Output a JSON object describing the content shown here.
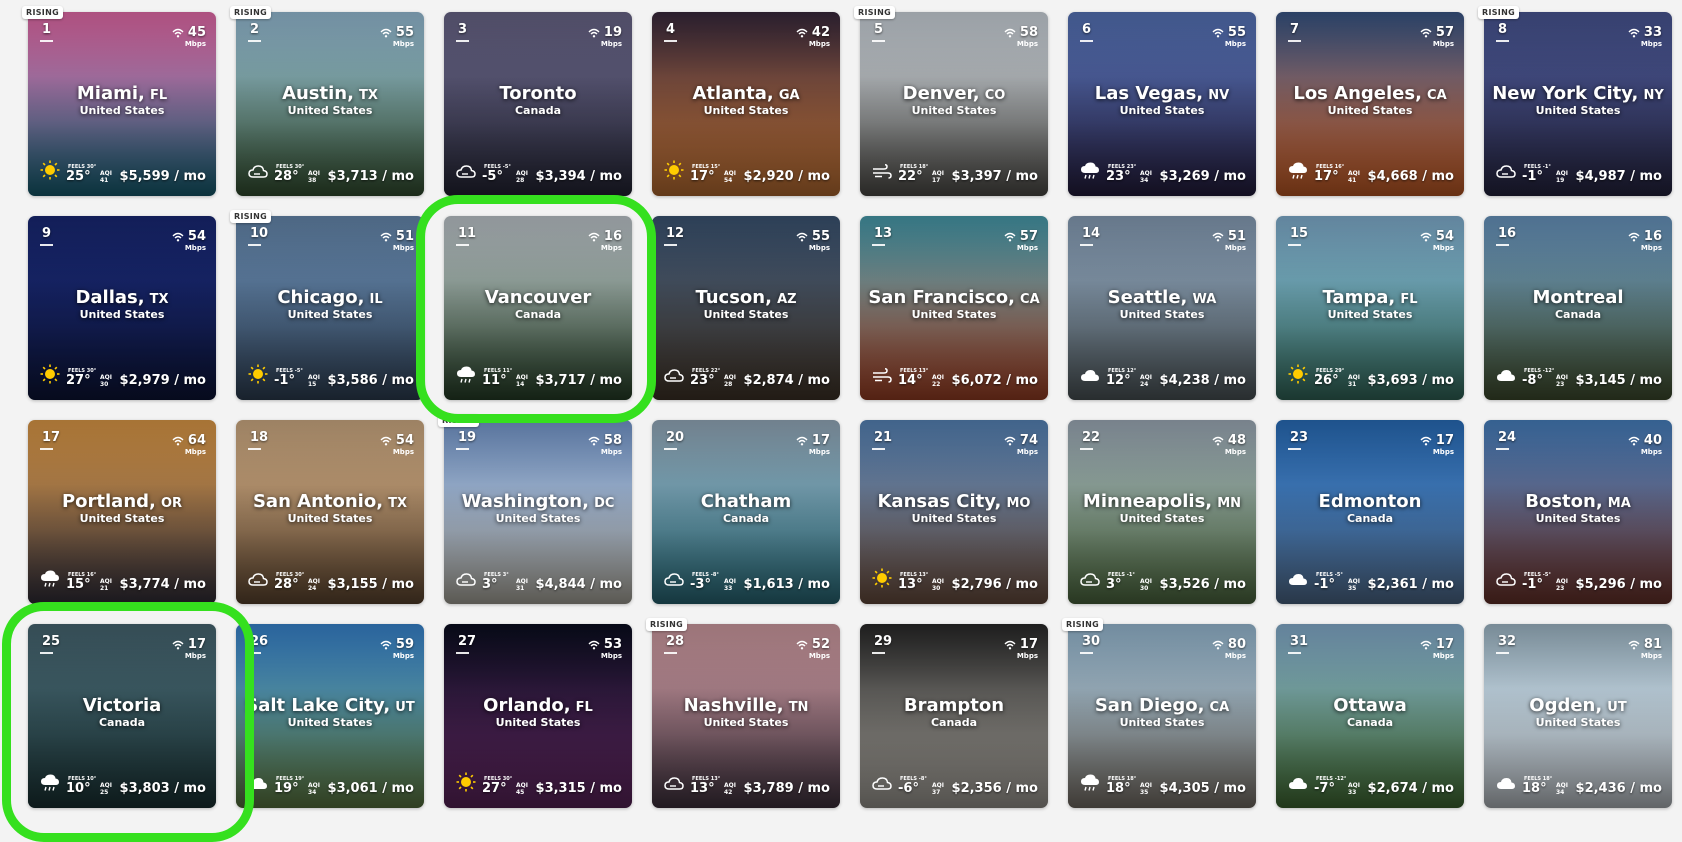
{
  "rising_label": "RISING",
  "wifi_unit": "Mbps",
  "feels_prefix": "FEELS",
  "aqi_label": "AQI",
  "price_suffix": "/ mo",
  "cities": [
    {
      "rank": "1",
      "city": "Miami,",
      "state": "FL",
      "country": "United States",
      "speed": "45",
      "temp": "25°",
      "feels": "30°",
      "aqi": "41",
      "price": "$5,599",
      "weather": "sun",
      "rising": true,
      "colors": [
        "#f06fb0",
        "#1a6f86"
      ]
    },
    {
      "rank": "2",
      "city": "Austin,",
      "state": "TX",
      "country": "United States",
      "speed": "55",
      "temp": "28°",
      "feels": "30°",
      "aqi": "38",
      "price": "$3,713",
      "weather": "cloudy",
      "rising": true,
      "colors": [
        "#9ec6e0",
        "#3d5e3a"
      ]
    },
    {
      "rank": "3",
      "city": "Toronto",
      "state": "",
      "country": "Canada",
      "speed": "19",
      "temp": "-5°",
      "feels": "-5°",
      "aqi": "28",
      "price": "$3,394",
      "weather": "cloudy",
      "rising": false,
      "colors": [
        "#6e6a8e",
        "#2a2b3d"
      ]
    },
    {
      "rank": "4",
      "city": "Atlanta,",
      "state": "GA",
      "country": "United States",
      "speed": "42",
      "temp": "17°",
      "feels": "15°",
      "aqi": "54",
      "price": "$2,920",
      "weather": "sun",
      "rising": false,
      "colors": [
        "#3a2a3e",
        "#d9803a"
      ]
    },
    {
      "rank": "5",
      "city": "Denver,",
      "state": "CO",
      "country": "United States",
      "speed": "58",
      "temp": "22°",
      "feels": "18°",
      "aqi": "17",
      "price": "$3,397",
      "weather": "wind",
      "rising": true,
      "colors": [
        "#d6dee6",
        "#5c5a55"
      ]
    },
    {
      "rank": "6",
      "city": "Las Vegas,",
      "state": "NV",
      "country": "United States",
      "speed": "55",
      "temp": "23°",
      "feels": "23°",
      "aqi": "34",
      "price": "$3,269",
      "weather": "rain",
      "rising": false,
      "colors": [
        "#5a79c0",
        "#2a2248"
      ]
    },
    {
      "rank": "7",
      "city": "Los Angeles,",
      "state": "CA",
      "country": "United States",
      "speed": "57",
      "temp": "17°",
      "feels": "16°",
      "aqi": "41",
      "price": "$4,668",
      "weather": "rain",
      "rising": false,
      "colors": [
        "#3b5a8c",
        "#e36a2a"
      ]
    },
    {
      "rank": "8",
      "city": "New York City,",
      "state": "NY",
      "country": "United States",
      "speed": "33",
      "temp": "-1°",
      "feels": "-1°",
      "aqi": "19",
      "price": "$4,987",
      "weather": "cloudy",
      "rising": true,
      "colors": [
        "#4c5a9a",
        "#2b2a4a"
      ]
    },
    {
      "rank": "9",
      "city": "Dallas,",
      "state": "TX",
      "country": "United States",
      "speed": "54",
      "temp": "27°",
      "feels": "30°",
      "aqi": "30",
      "price": "$2,979",
      "weather": "sun",
      "rising": false,
      "colors": [
        "#1a2a7a",
        "#0e1740"
      ]
    },
    {
      "rank": "10",
      "city": "Chicago,",
      "state": "IL",
      "country": "United States",
      "speed": "51",
      "temp": "-1°",
      "feels": "-5°",
      "aqi": "15",
      "price": "$3,586",
      "weather": "sun",
      "rising": true,
      "colors": [
        "#6b8fb6",
        "#364a62"
      ]
    },
    {
      "rank": "11",
      "city": "Vancouver",
      "state": "",
      "country": "Canada",
      "speed": "16",
      "temp": "11°",
      "feels": "11°",
      "aqi": "14",
      "price": "$3,717",
      "weather": "rain",
      "rising": false,
      "colors": [
        "#c8d0d6",
        "#2d4a2e"
      ]
    },
    {
      "rank": "12",
      "city": "Tucson,",
      "state": "AZ",
      "country": "United States",
      "speed": "55",
      "temp": "23°",
      "feels": "22°",
      "aqi": "28",
      "price": "$2,874",
      "weather": "cloudy",
      "rising": false,
      "colors": [
        "#3e5878",
        "#4a3c2e"
      ]
    },
    {
      "rank": "13",
      "city": "San Francisco,",
      "state": "CA",
      "country": "United States",
      "speed": "57",
      "temp": "14°",
      "feels": "13°",
      "aqi": "22",
      "price": "$6,072",
      "weather": "wind",
      "rising": false,
      "colors": [
        "#4aa3b5",
        "#b84a2a"
      ]
    },
    {
      "rank": "14",
      "city": "Seattle,",
      "state": "WA",
      "country": "United States",
      "speed": "51",
      "temp": "12°",
      "feels": "12°",
      "aqi": "24",
      "price": "$4,238",
      "weather": "cloud",
      "rising": false,
      "colors": [
        "#8ea6c0",
        "#5a6468"
      ]
    },
    {
      "rank": "15",
      "city": "Tampa,",
      "state": "FL",
      "country": "United States",
      "speed": "54",
      "temp": "26°",
      "feels": "29°",
      "aqi": "31",
      "price": "$3,693",
      "weather": "sun",
      "rising": false,
      "colors": [
        "#88b8da",
        "#3b7a6a"
      ]
    },
    {
      "rank": "16",
      "city": "Montreal",
      "state": "",
      "country": "Canada",
      "speed": "16",
      "temp": "-8°",
      "feels": "-12°",
      "aqi": "23",
      "price": "$3,145",
      "weather": "cloud",
      "rising": false,
      "colors": [
        "#6d9cc8",
        "#4a5a36"
      ]
    },
    {
      "rank": "17",
      "city": "Portland,",
      "state": "OR",
      "country": "United States",
      "speed": "64",
      "temp": "15°",
      "feels": "16°",
      "aqi": "21",
      "price": "$3,774",
      "weather": "rain",
      "rising": false,
      "colors": [
        "#e7a04a",
        "#3a3642"
      ]
    },
    {
      "rank": "18",
      "city": "San Antonio,",
      "state": "TX",
      "country": "United States",
      "speed": "54",
      "temp": "28°",
      "feels": "30°",
      "aqi": "24",
      "price": "$3,155",
      "weather": "cloudy",
      "rising": false,
      "colors": [
        "#d9b48a",
        "#6e5238"
      ]
    },
    {
      "rank": "19",
      "city": "Washington,",
      "state": "DC",
      "country": "United States",
      "speed": "58",
      "temp": "3°",
      "feels": "3°",
      "aqi": "31",
      "price": "$4,844",
      "weather": "cloudy",
      "rising": true,
      "colors": [
        "#7aa0d8",
        "#c8c4b8"
      ]
    },
    {
      "rank": "20",
      "city": "Chatham",
      "state": "",
      "country": "Canada",
      "speed": "17",
      "temp": "-3°",
      "feels": "-8°",
      "aqi": "33",
      "price": "$1,613",
      "weather": "cloudy",
      "rising": false,
      "colors": [
        "#9cb2c4",
        "#2f7a8a"
      ]
    },
    {
      "rank": "21",
      "city": "Kansas City,",
      "state": "MO",
      "country": "United States",
      "speed": "74",
      "temp": "13°",
      "feels": "13°",
      "aqi": "30",
      "price": "$2,796",
      "weather": "sun",
      "rising": false,
      "colors": [
        "#5a8ac0",
        "#7a5a48"
      ]
    },
    {
      "rank": "22",
      "city": "Minneapolis,",
      "state": "MN",
      "country": "United States",
      "speed": "48",
      "temp": "3°",
      "feels": "-1°",
      "aqi": "30",
      "price": "$3,526",
      "weather": "cloudy",
      "rising": false,
      "colors": [
        "#a6b4c2",
        "#5a7a4a"
      ]
    },
    {
      "rank": "23",
      "city": "Edmonton",
      "state": "",
      "country": "Canada",
      "speed": "17",
      "temp": "-1°",
      "feels": "-5°",
      "aqi": "35",
      "price": "$2,361",
      "weather": "cloud",
      "rising": false,
      "colors": [
        "#2a72c2",
        "#5a7aa0"
      ]
    },
    {
      "rank": "24",
      "city": "Boston,",
      "state": "MA",
      "country": "United States",
      "speed": "40",
      "temp": "-1°",
      "feels": "-5°",
      "aqi": "23",
      "price": "$5,296",
      "weather": "cloudy",
      "rising": false,
      "colors": [
        "#4a86c8",
        "#7a3a30"
      ]
    },
    {
      "rank": "25",
      "city": "Victoria",
      "state": "",
      "country": "Canada",
      "speed": "17",
      "temp": "10°",
      "feels": "10°",
      "aqi": "25",
      "price": "$3,803",
      "weather": "rain",
      "rising": false,
      "colors": [
        "#4a6a76",
        "#1e3a3c"
      ]
    },
    {
      "rank": "26",
      "city": "Salt Lake City,",
      "state": "UT",
      "country": "United States",
      "speed": "59",
      "temp": "19°",
      "feels": "19°",
      "aqi": "34",
      "price": "$3,061",
      "weather": "cloud",
      "rising": false,
      "colors": [
        "#3a8ad8",
        "#6a8a4a"
      ]
    },
    {
      "rank": "27",
      "city": "Orlando,",
      "state": "FL",
      "country": "United States",
      "speed": "53",
      "temp": "27°",
      "feels": "30°",
      "aqi": "45",
      "price": "$3,315",
      "weather": "sun",
      "rising": false,
      "colors": [
        "#0a0e20",
        "#6a2a6a"
      ]
    },
    {
      "rank": "28",
      "city": "Nashville,",
      "state": "TN",
      "country": "United States",
      "speed": "52",
      "temp": "13°",
      "feels": "13°",
      "aqi": "42",
      "price": "$3,789",
      "weather": "cloudy",
      "rising": true,
      "colors": [
        "#d8a2a8",
        "#4a3a48"
      ]
    },
    {
      "rank": "29",
      "city": "Brampton",
      "state": "",
      "country": "Canada",
      "speed": "17",
      "temp": "-6°",
      "feels": "-8°",
      "aqi": "37",
      "price": "$2,356",
      "weather": "cloudy",
      "rising": false,
      "colors": [
        "#2a2a2a",
        "#b8b4ac"
      ]
    },
    {
      "rank": "30",
      "city": "San Diego,",
      "state": "CA",
      "country": "United States",
      "speed": "80",
      "temp": "18°",
      "feels": "18°",
      "aqi": "35",
      "price": "$4,305",
      "weather": "rain",
      "rising": true,
      "colors": [
        "#9ec2dc",
        "#8a8278"
      ]
    },
    {
      "rank": "31",
      "city": "Ottawa",
      "state": "",
      "country": "Canada",
      "speed": "17",
      "temp": "-7°",
      "feels": "-12°",
      "aqi": "33",
      "price": "$2,674",
      "weather": "cloud",
      "rising": false,
      "colors": [
        "#8ab4d6",
        "#4a7a3a"
      ]
    },
    {
      "rank": "32",
      "city": "Ogden,",
      "state": "UT",
      "country": "United States",
      "speed": "81",
      "temp": "18°",
      "feels": "18°",
      "aqi": "34",
      "price": "$2,436",
      "weather": "cloud",
      "rising": false,
      "colors": [
        "#a6c0d0",
        "#d8dee4"
      ]
    }
  ],
  "highlights": [
    {
      "label": "Vancouver"
    },
    {
      "label": "Victoria"
    }
  ]
}
